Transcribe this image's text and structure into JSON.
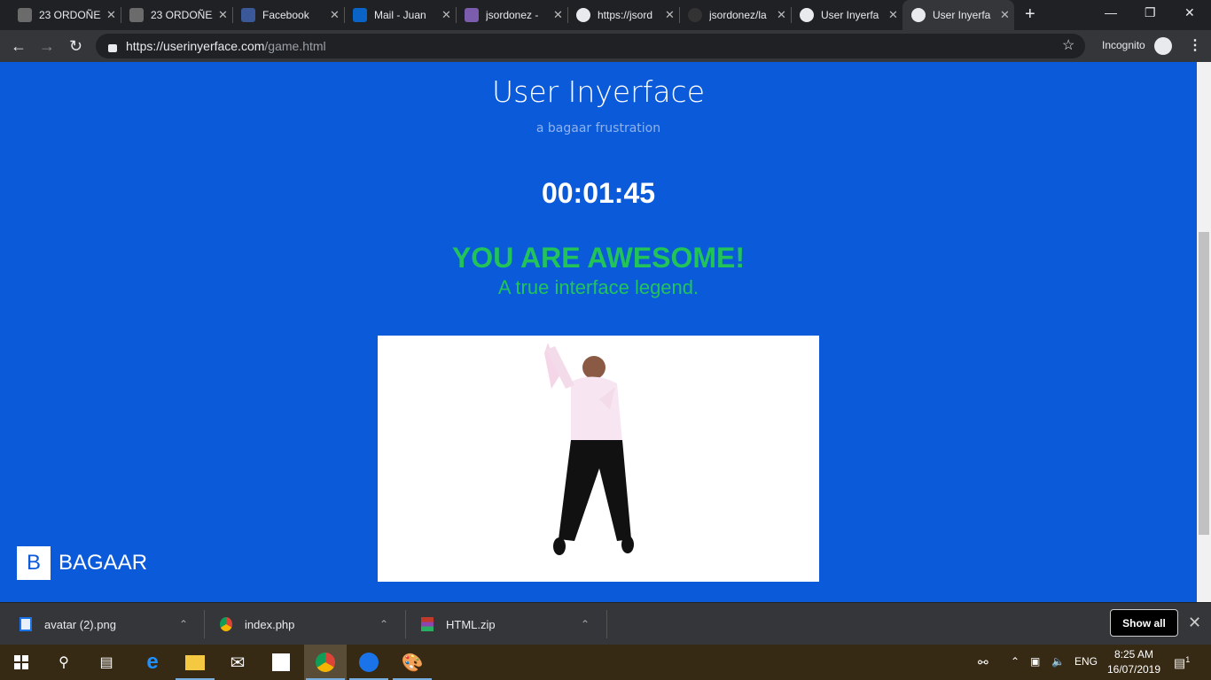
{
  "browser": {
    "tabs": [
      {
        "label": "23 ORDOÑEZ",
        "icon": "trello-icon",
        "color": "#6b6b6b"
      },
      {
        "label": "23 ORDOÑEZ",
        "icon": "trello-icon",
        "color": "#6b6b6b"
      },
      {
        "label": "Facebook",
        "icon": "facebook-icon",
        "color": "#3b5998"
      },
      {
        "label": "Mail - Juan",
        "icon": "outlook-icon",
        "color": "#0a64c8"
      },
      {
        "label": "jsordonez -",
        "icon": "heroku-icon",
        "color": "#7b5cad"
      },
      {
        "label": "https://jsord",
        "icon": "globe-icon",
        "color": "#e8eaed"
      },
      {
        "label": "jsordonez/la",
        "icon": "github-icon",
        "color": "#333"
      },
      {
        "label": "User Inyerfa",
        "icon": "globe-icon",
        "color": "#e8eaed"
      },
      {
        "label": "User Inyerfa",
        "icon": "globe-icon",
        "color": "#e8eaed",
        "active": true
      }
    ],
    "url_host": "https://userinyerface.com",
    "url_path": "/game.html",
    "incognito_label": "Incognito"
  },
  "page": {
    "title": "User Inyerface",
    "subtitle": "a bagaar frustration",
    "timer": "00:01:45",
    "headline": "YOU ARE AWESOME!",
    "tagline": "A true interface legend.",
    "brand_letter": "B",
    "brand_name": "BAGAAR",
    "colors": {
      "background": "#0b5ad9",
      "success": "#22c45a"
    }
  },
  "downloads": {
    "items": [
      {
        "name": "avatar (2).png",
        "icon": "image-file-icon"
      },
      {
        "name": "index.php",
        "icon": "chrome-icon"
      },
      {
        "name": "HTML.zip",
        "icon": "winrar-icon"
      }
    ],
    "show_all": "Show all"
  },
  "taskbar": {
    "language": "ENG",
    "time": "8:25 AM",
    "date": "16/07/2019",
    "notifications": "1"
  }
}
